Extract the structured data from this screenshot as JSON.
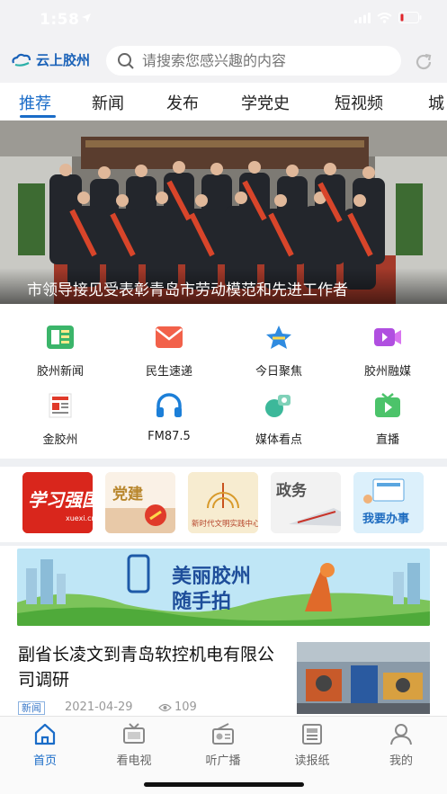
{
  "status_bar": {
    "time": "1:58"
  },
  "header": {
    "logo_text": "云上胶州",
    "search_placeholder": "请搜索您感兴趣的内容"
  },
  "tabs": [
    {
      "label": "推荐",
      "active": true
    },
    {
      "label": "新闻",
      "active": false
    },
    {
      "label": "发布",
      "active": false
    },
    {
      "label": "学党史",
      "active": false
    },
    {
      "label": "短视频",
      "active": false
    },
    {
      "label": "城",
      "active": false
    }
  ],
  "banner": {
    "caption": "市领导接见受表彰青岛市劳动模范和先进工作者"
  },
  "quick_links": [
    {
      "label": "胶州新闻",
      "icon": "newspaper-icon"
    },
    {
      "label": "民生速递",
      "icon": "envelope-icon"
    },
    {
      "label": "今日聚焦",
      "icon": "star-icon"
    },
    {
      "label": "胶州融媒",
      "icon": "video-camera-icon"
    },
    {
      "label": "金胶州",
      "icon": "newspaper-red-icon"
    },
    {
      "label": "FM87.5",
      "icon": "headphones-icon"
    },
    {
      "label": "媒体看点",
      "icon": "media-icon"
    },
    {
      "label": "直播",
      "icon": "live-tv-icon"
    }
  ],
  "feature_cards": [
    {
      "label": "学习强国",
      "sublabel": "xuexi.cn"
    },
    {
      "label": "党建"
    },
    {
      "label": "新时代文明实践中心"
    },
    {
      "label": "政务"
    },
    {
      "label": "我要办事"
    }
  ],
  "promo": {
    "line1": "美丽胶州",
    "line2": "随手拍"
  },
  "news": {
    "title": "副省长凌文到青岛软控机电有限公司调研",
    "tag": "新闻",
    "date": "2021-04-29",
    "views": "109"
  },
  "bottom_nav": [
    {
      "label": "首页",
      "active": true
    },
    {
      "label": "看电视",
      "active": false
    },
    {
      "label": "听广播",
      "active": false
    },
    {
      "label": "读报纸",
      "active": false
    },
    {
      "label": "我的",
      "active": false
    }
  ],
  "colors": {
    "accent": "#1a6cc8",
    "brand_red": "#d9261c"
  }
}
